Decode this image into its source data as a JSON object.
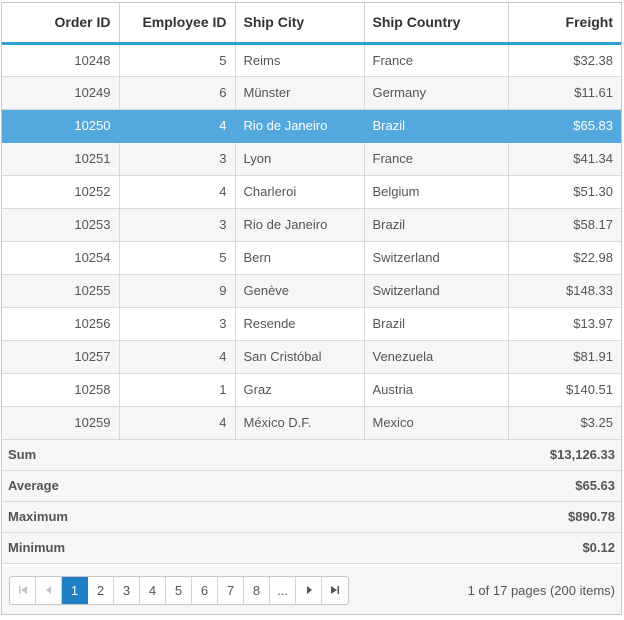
{
  "columns": [
    "Order ID",
    "Employee ID",
    "Ship City",
    "Ship Country",
    "Freight"
  ],
  "rows": [
    {
      "order_id": "10248",
      "employee_id": "5",
      "ship_city": "Reims",
      "ship_country": "France",
      "freight": "$32.38"
    },
    {
      "order_id": "10249",
      "employee_id": "6",
      "ship_city": "Münster",
      "ship_country": "Germany",
      "freight": "$11.61"
    },
    {
      "order_id": "10250",
      "employee_id": "4",
      "ship_city": "Rio de Janeiro",
      "ship_country": "Brazil",
      "freight": "$65.83"
    },
    {
      "order_id": "10251",
      "employee_id": "3",
      "ship_city": "Lyon",
      "ship_country": "France",
      "freight": "$41.34"
    },
    {
      "order_id": "10252",
      "employee_id": "4",
      "ship_city": "Charleroi",
      "ship_country": "Belgium",
      "freight": "$51.30"
    },
    {
      "order_id": "10253",
      "employee_id": "3",
      "ship_city": "Rio de Janeiro",
      "ship_country": "Brazil",
      "freight": "$58.17"
    },
    {
      "order_id": "10254",
      "employee_id": "5",
      "ship_city": "Bern",
      "ship_country": "Switzerland",
      "freight": "$22.98"
    },
    {
      "order_id": "10255",
      "employee_id": "9",
      "ship_city": "Genève",
      "ship_country": "Switzerland",
      "freight": "$148.33"
    },
    {
      "order_id": "10256",
      "employee_id": "3",
      "ship_city": "Resende",
      "ship_country": "Brazil",
      "freight": "$13.97"
    },
    {
      "order_id": "10257",
      "employee_id": "4",
      "ship_city": "San Cristóbal",
      "ship_country": "Venezuela",
      "freight": "$81.91"
    },
    {
      "order_id": "10258",
      "employee_id": "1",
      "ship_city": "Graz",
      "ship_country": "Austria",
      "freight": "$140.51"
    },
    {
      "order_id": "10259",
      "employee_id": "4",
      "ship_city": "México D.F.",
      "ship_country": "Mexico",
      "freight": "$3.25"
    }
  ],
  "selected_row": 2,
  "aggregates": [
    {
      "label": "Sum",
      "value": "$13,126.33"
    },
    {
      "label": "Average",
      "value": "$65.63"
    },
    {
      "label": "Maximum",
      "value": "$890.78"
    },
    {
      "label": "Minimum",
      "value": "$0.12"
    }
  ],
  "pager": {
    "pages": [
      "1",
      "2",
      "3",
      "4",
      "5",
      "6",
      "7",
      "8",
      "..."
    ],
    "current_page": "1",
    "info": "1 of 17 pages (200 items)",
    "icons": {
      "first": "first-page-icon",
      "prev": "previous-page-icon",
      "next": "next-page-icon",
      "last": "last-page-icon"
    }
  },
  "colors": {
    "accent": "#2e9fd6",
    "selected_row": "#53a8de",
    "active_page": "#1f7fc7"
  }
}
